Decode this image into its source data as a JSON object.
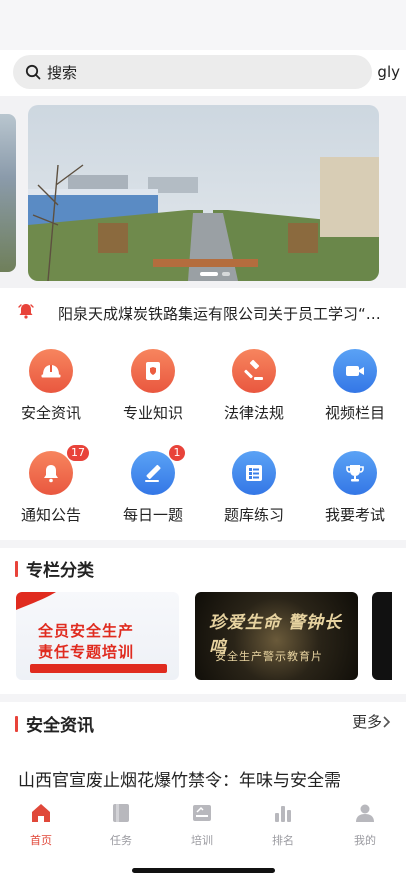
{
  "search": {
    "placeholder": "搜索"
  },
  "user": {
    "name": "gly"
  },
  "notice": {
    "text": "阳泉天成煤炭铁路集运有限公司关于员工学习“…"
  },
  "grid": [
    {
      "label": "安全资讯",
      "icon": "helmet-icon",
      "color": "#ec5c3f"
    },
    {
      "label": "专业知识",
      "icon": "book-icon",
      "color": "#ec5c3f"
    },
    {
      "label": "法律法规",
      "icon": "gavel-icon",
      "color": "#ec5c3f"
    },
    {
      "label": "视频栏目",
      "icon": "video-icon",
      "color": "#3a7fe9"
    },
    {
      "label": "通知公告",
      "icon": "bell-icon",
      "color": "#ec5c3f",
      "badge": "17"
    },
    {
      "label": "每日一题",
      "icon": "pencil-icon",
      "color": "#3a7fe9",
      "badge": "1"
    },
    {
      "label": "题库练习",
      "icon": "list-icon",
      "color": "#3a7fe9"
    },
    {
      "label": "我要考试",
      "icon": "trophy-icon",
      "color": "#3a7fe9"
    }
  ],
  "columns": {
    "title": "专栏分类",
    "cards": [
      {
        "line1": "全员安全生产",
        "line2": "责任专题培训"
      },
      {
        "line1": "珍爱生命 警钟长鸣",
        "line2": "安全生产警示教育片"
      }
    ]
  },
  "news": {
    "title": "安全资讯",
    "more": "更多",
    "first_item": "山西官宣废止烟花爆竹禁令：年味与安全需"
  },
  "tabs": [
    {
      "label": "首页",
      "icon": "home-icon",
      "active": true
    },
    {
      "label": "任务",
      "icon": "task-icon",
      "active": false
    },
    {
      "label": "培训",
      "icon": "training-icon",
      "active": false
    },
    {
      "label": "排名",
      "icon": "ranking-icon",
      "active": false
    },
    {
      "label": "我的",
      "icon": "profile-icon",
      "active": false
    }
  ],
  "colors": {
    "accent": "#e8433a",
    "blue": "#3a7fe9",
    "tab_active": "#e0483a"
  }
}
